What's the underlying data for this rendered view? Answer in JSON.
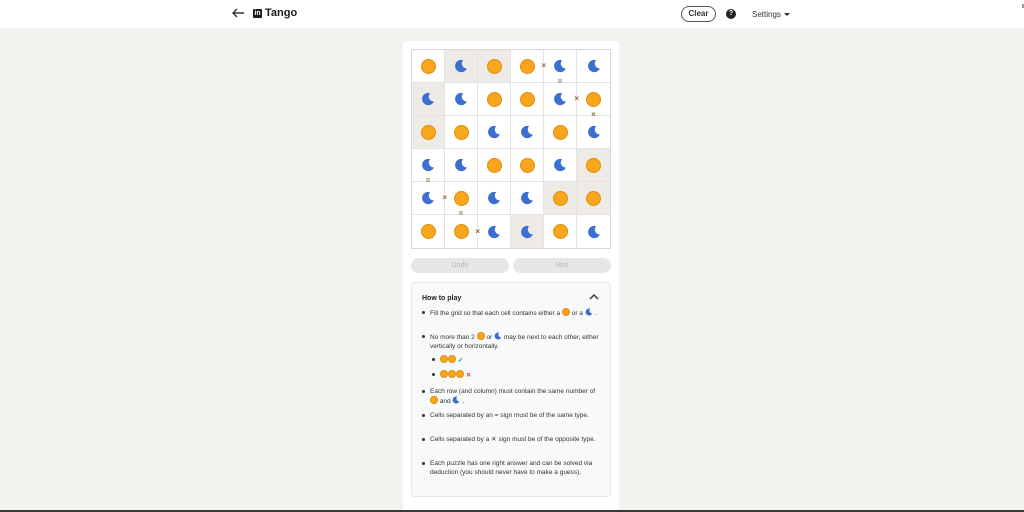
{
  "header": {
    "app_title": "Tango",
    "logo_text": "in",
    "clear_label": "Clear",
    "help_label": "?",
    "settings_label": "Settings"
  },
  "board": {
    "rows": [
      [
        "sun",
        "moon",
        "sun",
        "sun",
        "moon",
        "moon"
      ],
      [
        "moon",
        "moon",
        "sun",
        "sun",
        "moon",
        "sun"
      ],
      [
        "sun",
        "sun",
        "moon",
        "moon",
        "sun",
        "moon"
      ],
      [
        "moon",
        "moon",
        "sun",
        "sun",
        "moon",
        "sun"
      ],
      [
        "moon",
        "sun",
        "moon",
        "moon",
        "sun",
        "sun"
      ],
      [
        "sun",
        "sun",
        "moon",
        "moon",
        "sun",
        "moon"
      ]
    ],
    "locked": [
      [
        false,
        true,
        true,
        false,
        false,
        false
      ],
      [
        true,
        false,
        false,
        false,
        false,
        false
      ],
      [
        true,
        false,
        false,
        false,
        false,
        false
      ],
      [
        false,
        false,
        false,
        false,
        false,
        true
      ],
      [
        false,
        false,
        false,
        false,
        true,
        true
      ],
      [
        false,
        false,
        false,
        true,
        false,
        false
      ]
    ],
    "horizontal_constraints": [
      {
        "row": 0,
        "after_col": 3,
        "sign": "×"
      },
      {
        "row": 1,
        "after_col": 4,
        "sign": "×"
      },
      {
        "row": 4,
        "after_col": 0,
        "sign": "×"
      },
      {
        "row": 5,
        "after_col": 1,
        "sign": "×"
      }
    ],
    "vertical_constraints": [
      {
        "col": 4,
        "after_row": 0,
        "sign": "="
      },
      {
        "col": 5,
        "after_row": 1,
        "sign": "×"
      },
      {
        "col": 0,
        "after_row": 3,
        "sign": "="
      },
      {
        "col": 1,
        "after_row": 4,
        "sign": "="
      }
    ],
    "sun_color": "#f8a61e",
    "moon_color": "#3b6fd1"
  },
  "controls": {
    "undo_label": "Undo",
    "hint_label": "Hint"
  },
  "how_to_play": {
    "title": "How to play",
    "rule1_a": "Fill the grid so that each cell contains either a",
    "rule1_b": "or",
    "rule1_c": "a",
    "rule1_end": ".",
    "rule2_a": "No more than 2",
    "rule2_b": "or",
    "rule2_c": "may be next to each other, either vertically or horizontally.",
    "example_ok": "✓",
    "example_bad": "✕",
    "rule3_a": "Each row (and column) must contain the same number of",
    "rule3_b": "and",
    "rule3_end": ".",
    "rule4": "Cells separated by an = sign must be of the same type.",
    "rule5_a": "Cells separated by a",
    "rule5_x": "✕",
    "rule5_b": "sign must be of the opposite type.",
    "rule6": "Each puzzle has one right answer and can be solved via deduction (you should never have to make a guess)."
  }
}
